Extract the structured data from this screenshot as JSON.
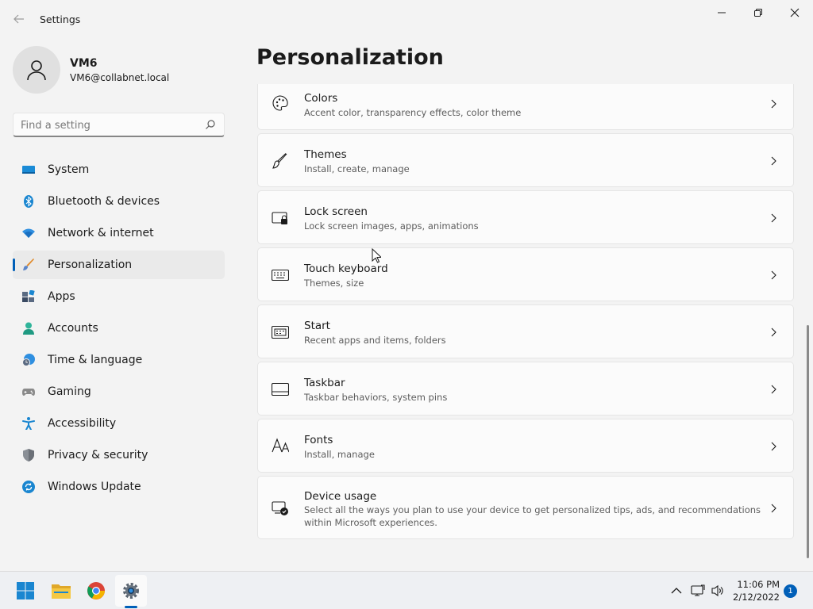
{
  "window": {
    "title": "Settings"
  },
  "profile": {
    "name": "VM6",
    "email": "VM6@collabnet.local"
  },
  "search": {
    "placeholder": "Find a setting",
    "value": ""
  },
  "sidebar": {
    "items": [
      {
        "label": "System",
        "icon": "monitor-icon"
      },
      {
        "label": "Bluetooth & devices",
        "icon": "bluetooth-icon"
      },
      {
        "label": "Network & internet",
        "icon": "wifi-icon"
      },
      {
        "label": "Personalization",
        "icon": "brush-icon",
        "active": true
      },
      {
        "label": "Apps",
        "icon": "apps-icon"
      },
      {
        "label": "Accounts",
        "icon": "person-icon"
      },
      {
        "label": "Time & language",
        "icon": "globe-clock-icon"
      },
      {
        "label": "Gaming",
        "icon": "gamepad-icon"
      },
      {
        "label": "Accessibility",
        "icon": "accessibility-icon"
      },
      {
        "label": "Privacy & security",
        "icon": "shield-icon"
      },
      {
        "label": "Windows Update",
        "icon": "update-icon"
      }
    ]
  },
  "main": {
    "title": "Personalization",
    "cards": [
      {
        "title": "Colors",
        "desc": "Accent color, transparency effects, color theme",
        "icon": "palette-icon"
      },
      {
        "title": "Themes",
        "desc": "Install, create, manage",
        "icon": "brush-icon"
      },
      {
        "title": "Lock screen",
        "desc": "Lock screen images, apps, animations",
        "icon": "lock-screen-icon"
      },
      {
        "title": "Touch keyboard",
        "desc": "Themes, size",
        "icon": "keyboard-icon"
      },
      {
        "title": "Start",
        "desc": "Recent apps and items, folders",
        "icon": "start-icon"
      },
      {
        "title": "Taskbar",
        "desc": "Taskbar behaviors, system pins",
        "icon": "taskbar-icon"
      },
      {
        "title": "Fonts",
        "desc": "Install, manage",
        "icon": "fonts-icon"
      },
      {
        "title": "Device usage",
        "desc": "Select all the ways you plan to use your device to get personalized tips, ads, and recommendations within Microsoft experiences.",
        "icon": "device-usage-icon"
      }
    ]
  },
  "taskbar": {
    "apps": [
      "windows-start-icon",
      "file-explorer-icon",
      "chrome-icon",
      "settings-icon"
    ],
    "time": "11:06 PM",
    "date": "2/12/2022",
    "notifications": "1"
  },
  "colors": {
    "accent": "#005fb8",
    "background": "#f3f3f3",
    "card": "#fbfbfb"
  }
}
